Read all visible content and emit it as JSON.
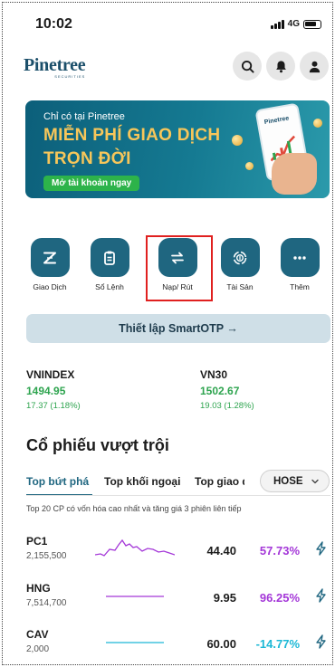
{
  "status_bar": {
    "time": "10:02",
    "network": "4G"
  },
  "header": {
    "logo_name": "Pinetree",
    "logo_sub": "SECURITIES"
  },
  "banner": {
    "tag": "Chỉ có tại Pinetree",
    "headline_1": "MIỄN PHÍ GIAO DỊCH",
    "headline_2": "TRỌN ĐỜI",
    "cta": "Mở tài khoản ngay",
    "phone_logo": "Pinetree"
  },
  "actions": [
    {
      "label": "Giao Dịch",
      "icon": "trade-z-icon"
    },
    {
      "label": "Sổ Lệnh",
      "icon": "order-book-icon"
    },
    {
      "label": "Nạp/ Rút",
      "icon": "transfer-arrows-icon"
    },
    {
      "label": "Tài Sản",
      "icon": "asset-icon"
    },
    {
      "label": "Thêm",
      "icon": "more-dots-icon"
    }
  ],
  "otp_button": "Thiết lập SmartOTP →",
  "indices": [
    {
      "name": "VNINDEX",
      "value": "1494.95",
      "change": "17.37 (1.18%)"
    },
    {
      "name": "VN30",
      "value": "1502.67",
      "change": "19.03 (1.28%)"
    }
  ],
  "section_title": "Cổ phiếu vượt trội",
  "tabs": [
    "Top bứt phá",
    "Top khối ngoại",
    "Top giao dịch"
  ],
  "exchange_select": "HOSE",
  "description": "Top 20 CP có vốn hóa cao nhất và tăng giá 3 phiên liên tiếp",
  "colors": {
    "primary": "#1f6680",
    "up": "#2ea44f",
    "ceiling": "#a437d8",
    "floor": "#1cb8d6",
    "highlight": "#e0201f"
  },
  "stocks": [
    {
      "symbol": "PC1",
      "volume": "2,155,500",
      "price": "44.40",
      "change": "57.73%",
      "color": "#a437d8"
    },
    {
      "symbol": "HNG",
      "volume": "7,514,700",
      "price": "9.95",
      "change": "96.25%",
      "color": "#a437d8"
    },
    {
      "symbol": "CAV",
      "volume": "2,000",
      "price": "60.00",
      "change": "-14.77%",
      "color": "#1cb8d6"
    }
  ]
}
